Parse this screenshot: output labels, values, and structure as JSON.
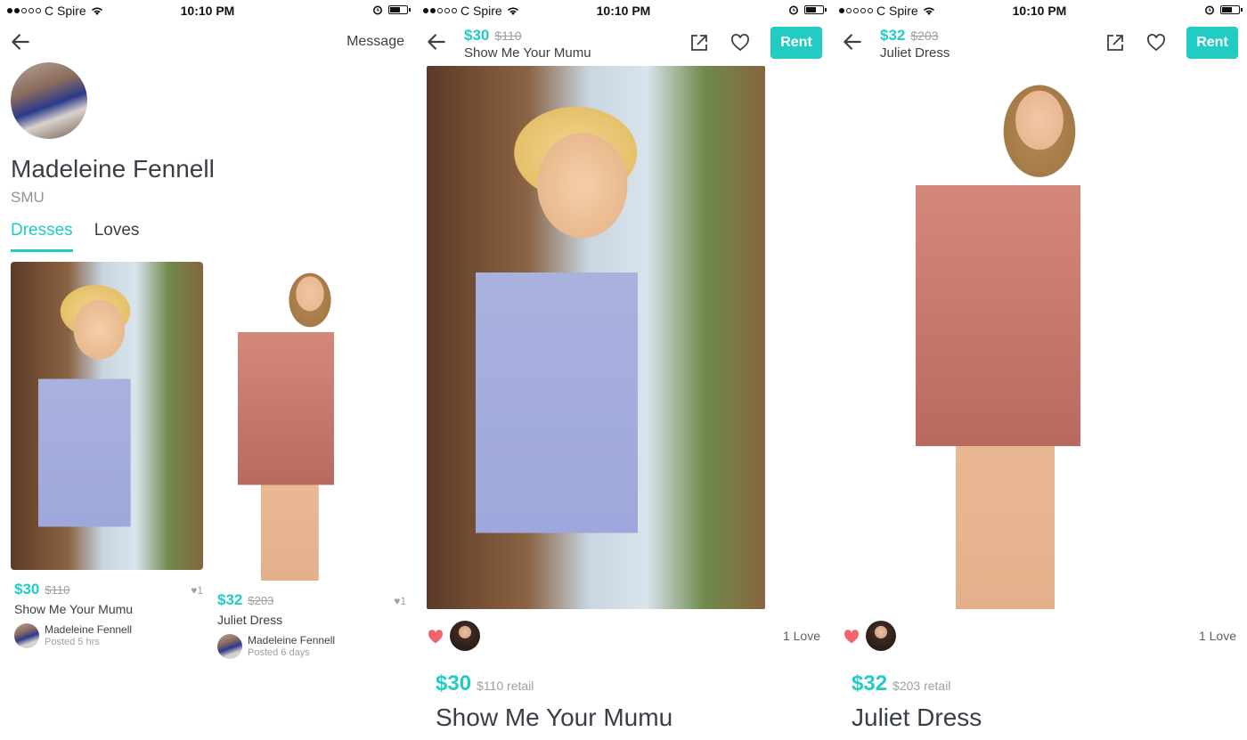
{
  "status": {
    "carrier": "C Spire",
    "time": "10:10 PM"
  },
  "profile_screen": {
    "message_label": "Message",
    "name": "Madeleine Fennell",
    "school": "SMU",
    "tabs": [
      {
        "label": "Dresses",
        "active": true
      },
      {
        "label": "Loves",
        "active": false
      }
    ],
    "items": [
      {
        "price": "$30",
        "retail": "$110",
        "title": "Show Me Your Mumu",
        "likes": "♥1",
        "owner": "Madeleine Fennell",
        "posted": "Posted 5 hrs"
      },
      {
        "price": "$32",
        "retail": "$203",
        "title": "Juliet Dress",
        "likes": "♥1",
        "owner": "Madeleine Fennell",
        "posted": "Posted 6 days"
      }
    ]
  },
  "detail_mumu": {
    "price": "$30",
    "retail": "$110",
    "title": "Show Me Your Mumu",
    "rent_label": "Rent",
    "love_count": "1 Love",
    "detail_price": "$30",
    "detail_retail": "$110 retail",
    "detail_title": "Show Me Your Mumu"
  },
  "detail_juliet": {
    "price": "$32",
    "retail": "$203",
    "title": "Juliet Dress",
    "rent_label": "Rent",
    "love_count": "1 Love",
    "detail_price": "$32",
    "detail_retail": "$203 retail",
    "detail_title": "Juliet Dress"
  },
  "colors": {
    "accent": "#22ccc3",
    "heart": "#f0656d",
    "text": "#3a3f47",
    "muted": "#9aa0a6"
  },
  "icons": [
    "back-arrow-icon",
    "wifi-icon",
    "alarm-icon",
    "battery-icon",
    "share-icon",
    "heart-outline-icon",
    "heart-filled-icon"
  ]
}
